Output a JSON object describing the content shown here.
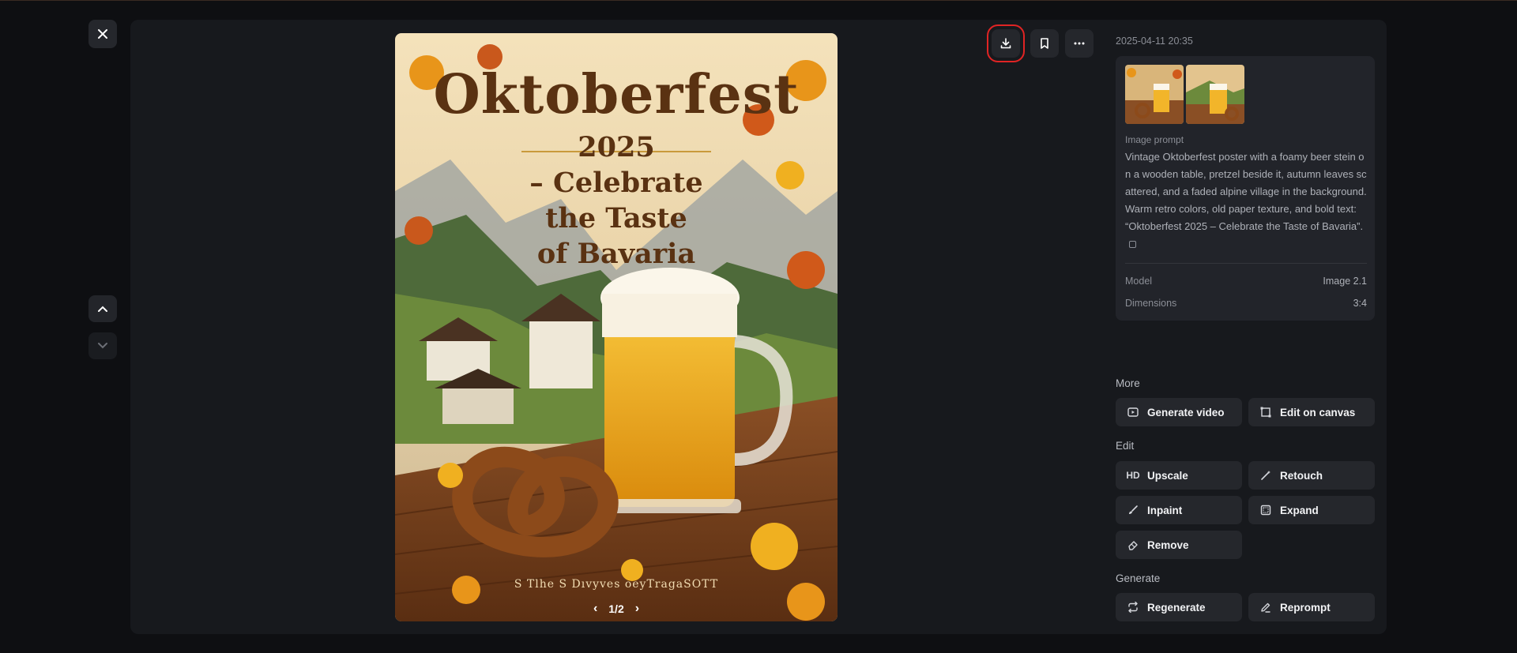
{
  "colors": {
    "background": "#0e0f12",
    "panel": "#17191d",
    "card": "#22242a",
    "button": "#25272c",
    "highlight": "#e02424"
  },
  "viewer": {
    "close_icon": "close-icon",
    "prev_icon": "chevron-up-icon",
    "next_icon": "chevron-down-icon"
  },
  "poster": {
    "title": "Oktoberfest",
    "subtitle_lines": [
      "2025",
      "– Celebrate",
      "the Taste",
      "of Bavaria"
    ],
    "footer": "S Tlhe S Dıvyves oeyTragaSOTT",
    "pager": {
      "label": "1/2"
    }
  },
  "actions": {
    "download_icon": "download-icon",
    "bookmark_icon": "bookmark-icon",
    "more_icon": "more-icon"
  },
  "details": {
    "timestamp": "2025-04-11 20:35",
    "prompt_label": "Image prompt",
    "prompt_text": "Vintage Oktoberfest poster with a foamy beer stein on a wooden table, pretzel beside it, autumn leaves scattered, and a faded alpine village in the background. Warm retro colors, old paper texture, and bold text: “Oktoberfest 2025 – Celebrate the Taste of Bavaria”.",
    "meta": [
      {
        "label": "Model",
        "value": "Image 2.1"
      },
      {
        "label": "Dimensions",
        "value": "3:4"
      }
    ]
  },
  "sections": {
    "more": {
      "label": "More",
      "buttons": [
        {
          "label": "Generate video",
          "icon": "video-icon"
        },
        {
          "label": "Edit on canvas",
          "icon": "canvas-icon"
        }
      ]
    },
    "edit": {
      "label": "Edit",
      "buttons": [
        {
          "label": "Upscale",
          "icon": "HD"
        },
        {
          "label": "Retouch",
          "icon": "wand-icon"
        },
        {
          "label": "Inpaint",
          "icon": "brush-icon"
        },
        {
          "label": "Expand",
          "icon": "expand-icon"
        },
        {
          "label": "Remove",
          "icon": "eraser-icon"
        }
      ]
    },
    "generate": {
      "label": "Generate",
      "buttons": [
        {
          "label": "Regenerate",
          "icon": "regenerate-icon"
        },
        {
          "label": "Reprompt",
          "icon": "pencil-icon"
        }
      ]
    }
  }
}
